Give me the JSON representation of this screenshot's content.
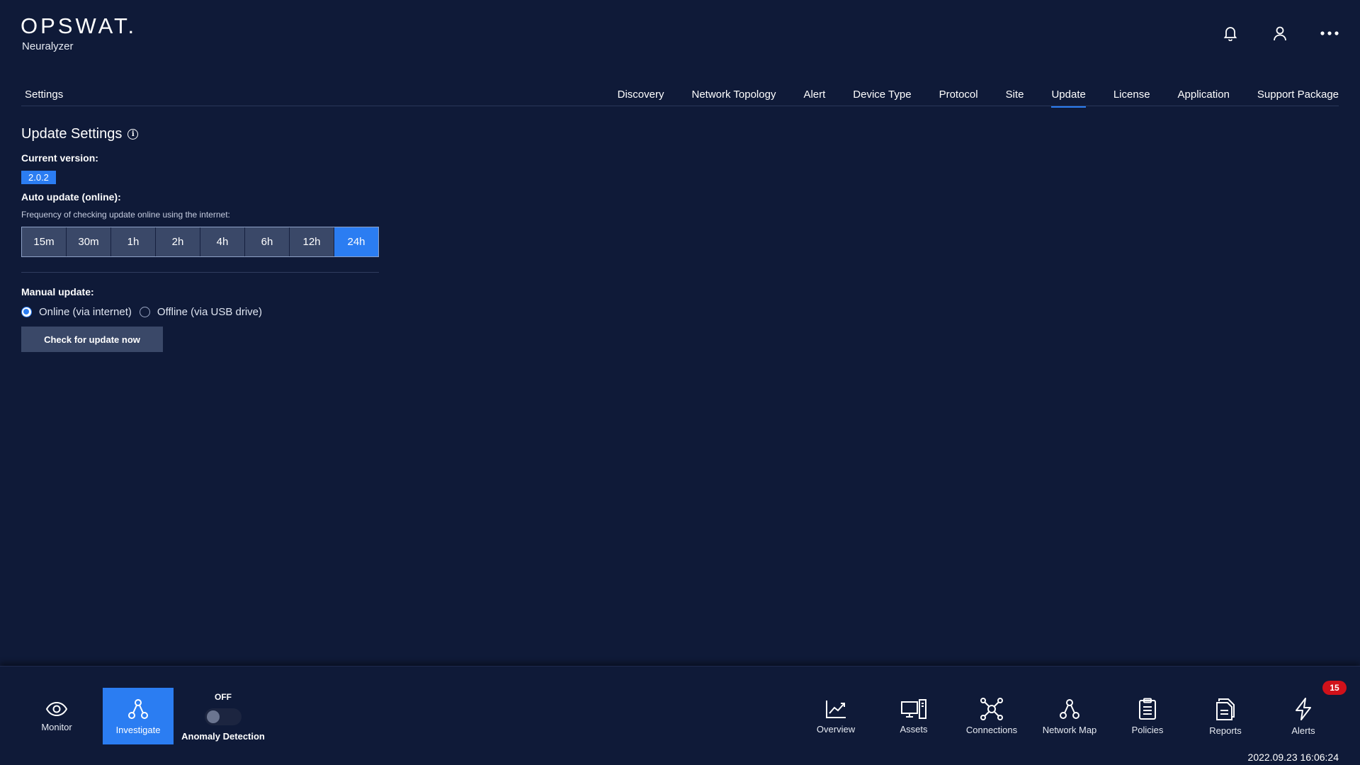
{
  "brand": {
    "logo": "OPSWAT.",
    "product": "Neuralyzer"
  },
  "header": {
    "icons": [
      "bell-icon",
      "user-icon",
      "more-icon"
    ]
  },
  "settings_title": "Settings",
  "tabs": [
    {
      "label": "Discovery",
      "active": false
    },
    {
      "label": "Network Topology",
      "active": false
    },
    {
      "label": "Alert",
      "active": false
    },
    {
      "label": "Device Type",
      "active": false
    },
    {
      "label": "Protocol",
      "active": false
    },
    {
      "label": "Site",
      "active": false
    },
    {
      "label": "Update",
      "active": true
    },
    {
      "label": "License",
      "active": false
    },
    {
      "label": "Application",
      "active": false
    },
    {
      "label": "Support Package",
      "active": false
    }
  ],
  "update": {
    "title": "Update Settings",
    "info_icon": "i",
    "current_version_label": "Current version:",
    "current_version": "2.0.2",
    "auto_update_label": "Auto update (online):",
    "frequency_hint": "Frequency of checking update online using the internet:",
    "frequencies": [
      "15m",
      "30m",
      "1h",
      "2h",
      "4h",
      "6h",
      "12h",
      "24h"
    ],
    "selected_frequency": "24h",
    "manual_update_label": "Manual update:",
    "manual_options": [
      {
        "label": "Online (via internet)",
        "checked": true
      },
      {
        "label": "Offline (via USB drive)",
        "checked": false
      }
    ],
    "check_button": "Check for update now"
  },
  "bottom_nav": {
    "left": [
      {
        "label": "Monitor",
        "icon": "eye-icon",
        "active": false
      },
      {
        "label": "Investigate",
        "icon": "network-icon",
        "active": true
      }
    ],
    "anomaly": {
      "state": "OFF",
      "label": "Anomaly Detection",
      "enabled": false
    },
    "right": [
      {
        "label": "Overview",
        "icon": "chart-icon"
      },
      {
        "label": "Assets",
        "icon": "devices-icon"
      },
      {
        "label": "Connections",
        "icon": "connections-icon"
      },
      {
        "label": "Network Map",
        "icon": "network-map-icon"
      },
      {
        "label": "Policies",
        "icon": "clipboard-icon"
      },
      {
        "label": "Reports",
        "icon": "reports-icon"
      },
      {
        "label": "Alerts",
        "icon": "lightning-icon"
      }
    ],
    "alerts_count": "15",
    "timestamp": "2022.09.23 16:06:24"
  },
  "colors": {
    "background": "#0f1a38",
    "accent": "#2b7df2",
    "button": "#3a4868",
    "badge": "#d0111a"
  }
}
